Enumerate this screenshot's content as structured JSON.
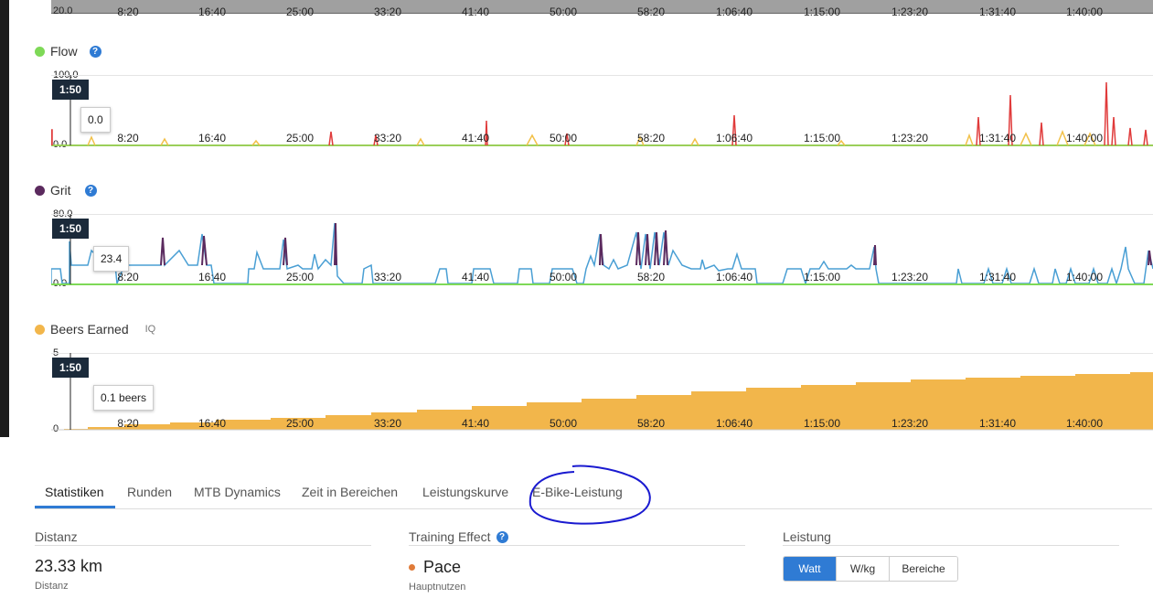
{
  "time_ticks": [
    "8:20",
    "16:40",
    "25:00",
    "33:20",
    "41:40",
    "50:00",
    "58:20",
    "1:06:40",
    "1:15:00",
    "1:23:20",
    "1:31:40",
    "1:40:00"
  ],
  "top_chart": {
    "ymin_label": "20.0"
  },
  "cursor": {
    "time": "1:50"
  },
  "flow": {
    "title": "Flow",
    "help": "?",
    "color": "#7ed957",
    "ymax_label": "100.0",
    "ymin_label": "0.0",
    "tooltip": "0.0"
  },
  "grit": {
    "title": "Grit",
    "help": "?",
    "color": "#5b2a5e",
    "ymax_label": "80.0",
    "ymin_label": "0.0",
    "tooltip": "23.4"
  },
  "beers": {
    "title": "Beers Earned",
    "badge": "IQ",
    "color": "#f2b64b",
    "ymax_label": "5",
    "ymin_label": "0",
    "tooltip": "0.1 beers"
  },
  "tabs": [
    "Statistiken",
    "Runden",
    "MTB Dynamics",
    "Zeit in Bereichen",
    "Leistungskurve",
    "E-Bike-Leistung"
  ],
  "stats": {
    "distance": {
      "title": "Distanz",
      "value": "23.33 km",
      "sub": "Distanz"
    },
    "training": {
      "title": "Training Effect",
      "help": "?",
      "value": "Pace",
      "sub": "Hauptnutzen",
      "dot_color": "#e07b39"
    },
    "power": {
      "title": "Leistung",
      "buttons": [
        "Watt",
        "W/kg",
        "Bereiche"
      ],
      "active": "Watt"
    }
  },
  "accent": "#2f7bd4"
}
